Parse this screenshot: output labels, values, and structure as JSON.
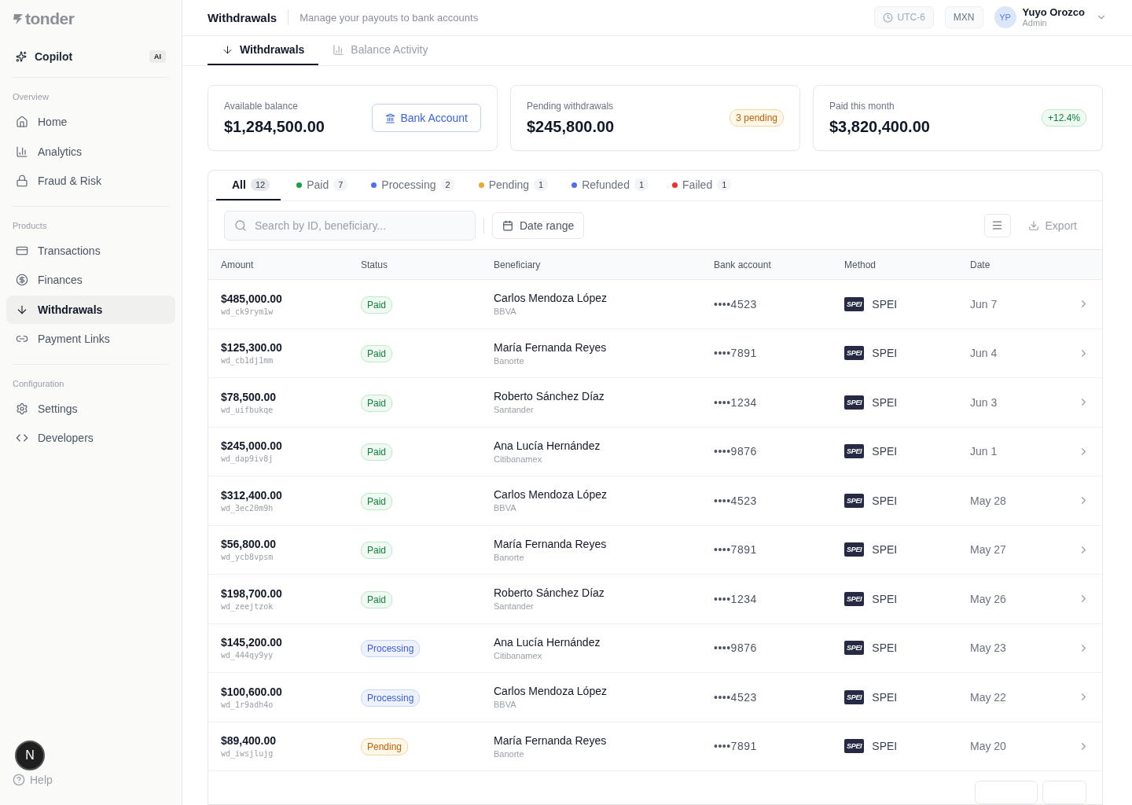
{
  "sidebar": {
    "logo": "tonder",
    "copilot": {
      "label": "Copilot",
      "badge": "AI"
    },
    "sections": [
      {
        "title": "Overview",
        "items": [
          {
            "label": "Home",
            "selected": false
          },
          {
            "label": "Analytics",
            "selected": false
          },
          {
            "label": "Fraud & Risk",
            "selected": false
          }
        ]
      },
      {
        "title": "Products",
        "items": [
          {
            "label": "Transactions",
            "selected": false
          },
          {
            "label": "Finances",
            "selected": false
          },
          {
            "label": "Withdrawals",
            "selected": true
          },
          {
            "label": "Payment Links",
            "selected": false
          }
        ]
      },
      {
        "title": "Configuration",
        "items": [
          {
            "label": "Settings",
            "selected": false
          },
          {
            "label": "Developers",
            "selected": false
          }
        ]
      }
    ],
    "help": "Help",
    "dev_badge": "N"
  },
  "header": {
    "title": "Withdrawals",
    "subtitle": "Manage your payouts to bank accounts",
    "timezone": "UTC-6",
    "currency": "MXN",
    "user": {
      "initials": "YP",
      "name": "Yuyo Orozco",
      "role": "Admin"
    }
  },
  "page_tabs": [
    {
      "label": "Withdrawals",
      "selected": true
    },
    {
      "label": "Balance Activity",
      "selected": false
    }
  ],
  "cards": [
    {
      "label": "Available balance",
      "value": "$1,284,500.00",
      "kind": "button",
      "extra": "Bank Account"
    },
    {
      "label": "Pending withdrawals",
      "value": "$245,800.00",
      "kind": "pending",
      "extra": "3 pending"
    },
    {
      "label": "Paid this month",
      "value": "$3,820,400.00",
      "kind": "positive",
      "extra": "+12.4%"
    }
  ],
  "filters": [
    {
      "label": "All",
      "count": "12",
      "selected": true
    },
    {
      "label": "Paid",
      "count": "7",
      "selected": false,
      "color": "#16a34a"
    },
    {
      "label": "Processing",
      "count": "2",
      "selected": false,
      "color": "#4f6ef7"
    },
    {
      "label": "Pending",
      "count": "1",
      "selected": false,
      "color": "#f0a830"
    },
    {
      "label": "Refunded",
      "count": "1",
      "selected": false,
      "color": "#4f6ef7"
    },
    {
      "label": "Failed",
      "count": "1",
      "selected": false,
      "color": "#ef2f2f"
    }
  ],
  "toolbar": {
    "search_placeholder": "Search by ID, beneficiary...",
    "date_range": "Date range",
    "export": "Export"
  },
  "table": {
    "columns": [
      "Amount",
      "Status",
      "Beneficiary",
      "Bank account",
      "Method",
      "Date"
    ],
    "rows": [
      {
        "amount": "$485,000.00",
        "id": "wd_ck9rym1w",
        "status": "Paid",
        "kind": "paid",
        "name": "Carlos Mendoza López",
        "bank": "BBVA",
        "account": "••••4523",
        "logo": "SPEI",
        "method": "SPEI",
        "date": "Jun 7"
      },
      {
        "amount": "$125,300.00",
        "id": "wd_cb1dj1mm",
        "status": "Paid",
        "kind": "paid",
        "name": "María Fernanda Reyes",
        "bank": "Banorte",
        "account": "••••7891",
        "logo": "SPEI",
        "method": "SPEI",
        "date": "Jun 4"
      },
      {
        "amount": "$78,500.00",
        "id": "wd_uifbukqe",
        "status": "Paid",
        "kind": "paid",
        "name": "Roberto Sánchez Díaz",
        "bank": "Santander",
        "account": "••••1234",
        "logo": "SPEI",
        "method": "SPEI",
        "date": "Jun 3"
      },
      {
        "amount": "$245,000.00",
        "id": "wd_dap9iv8j",
        "status": "Paid",
        "kind": "paid",
        "name": "Ana Lucía Hernández",
        "bank": "Citibanamex",
        "account": "••••9876",
        "logo": "SPEI",
        "method": "SPEI",
        "date": "Jun 1"
      },
      {
        "amount": "$312,400.00",
        "id": "wd_3ec20m9h",
        "status": "Paid",
        "kind": "paid",
        "name": "Carlos Mendoza López",
        "bank": "BBVA",
        "account": "••••4523",
        "logo": "SPEI",
        "method": "SPEI",
        "date": "May 28"
      },
      {
        "amount": "$56,800.00",
        "id": "wd_ycb8vpsm",
        "status": "Paid",
        "kind": "paid",
        "name": "María Fernanda Reyes",
        "bank": "Banorte",
        "account": "••••7891",
        "logo": "SPEI",
        "method": "SPEI",
        "date": "May 27"
      },
      {
        "amount": "$198,700.00",
        "id": "wd_zeejtzok",
        "status": "Paid",
        "kind": "paid",
        "name": "Roberto Sánchez Díaz",
        "bank": "Santander",
        "account": "••••1234",
        "logo": "SPEI",
        "method": "SPEI",
        "date": "May 26"
      },
      {
        "amount": "$145,200.00",
        "id": "wd_444qy9yy",
        "status": "Processing",
        "kind": "processing",
        "name": "Ana Lucía Hernández",
        "bank": "Citibanamex",
        "account": "••••9876",
        "logo": "SPEI",
        "method": "SPEI",
        "date": "May 23"
      },
      {
        "amount": "$100,600.00",
        "id": "wd_1r9adh4o",
        "status": "Processing",
        "kind": "processing",
        "name": "Carlos Mendoza López",
        "bank": "BBVA",
        "account": "••••4523",
        "logo": "SPEI",
        "method": "SPEI",
        "date": "May 22"
      },
      {
        "amount": "$89,400.00",
        "id": "wd_iwsjlujg",
        "status": "Pending",
        "kind": "pending",
        "name": "María Fernanda Reyes",
        "bank": "Banorte",
        "account": "••••7891",
        "logo": "SPEI",
        "method": "SPEI",
        "date": "May 20"
      }
    ]
  }
}
